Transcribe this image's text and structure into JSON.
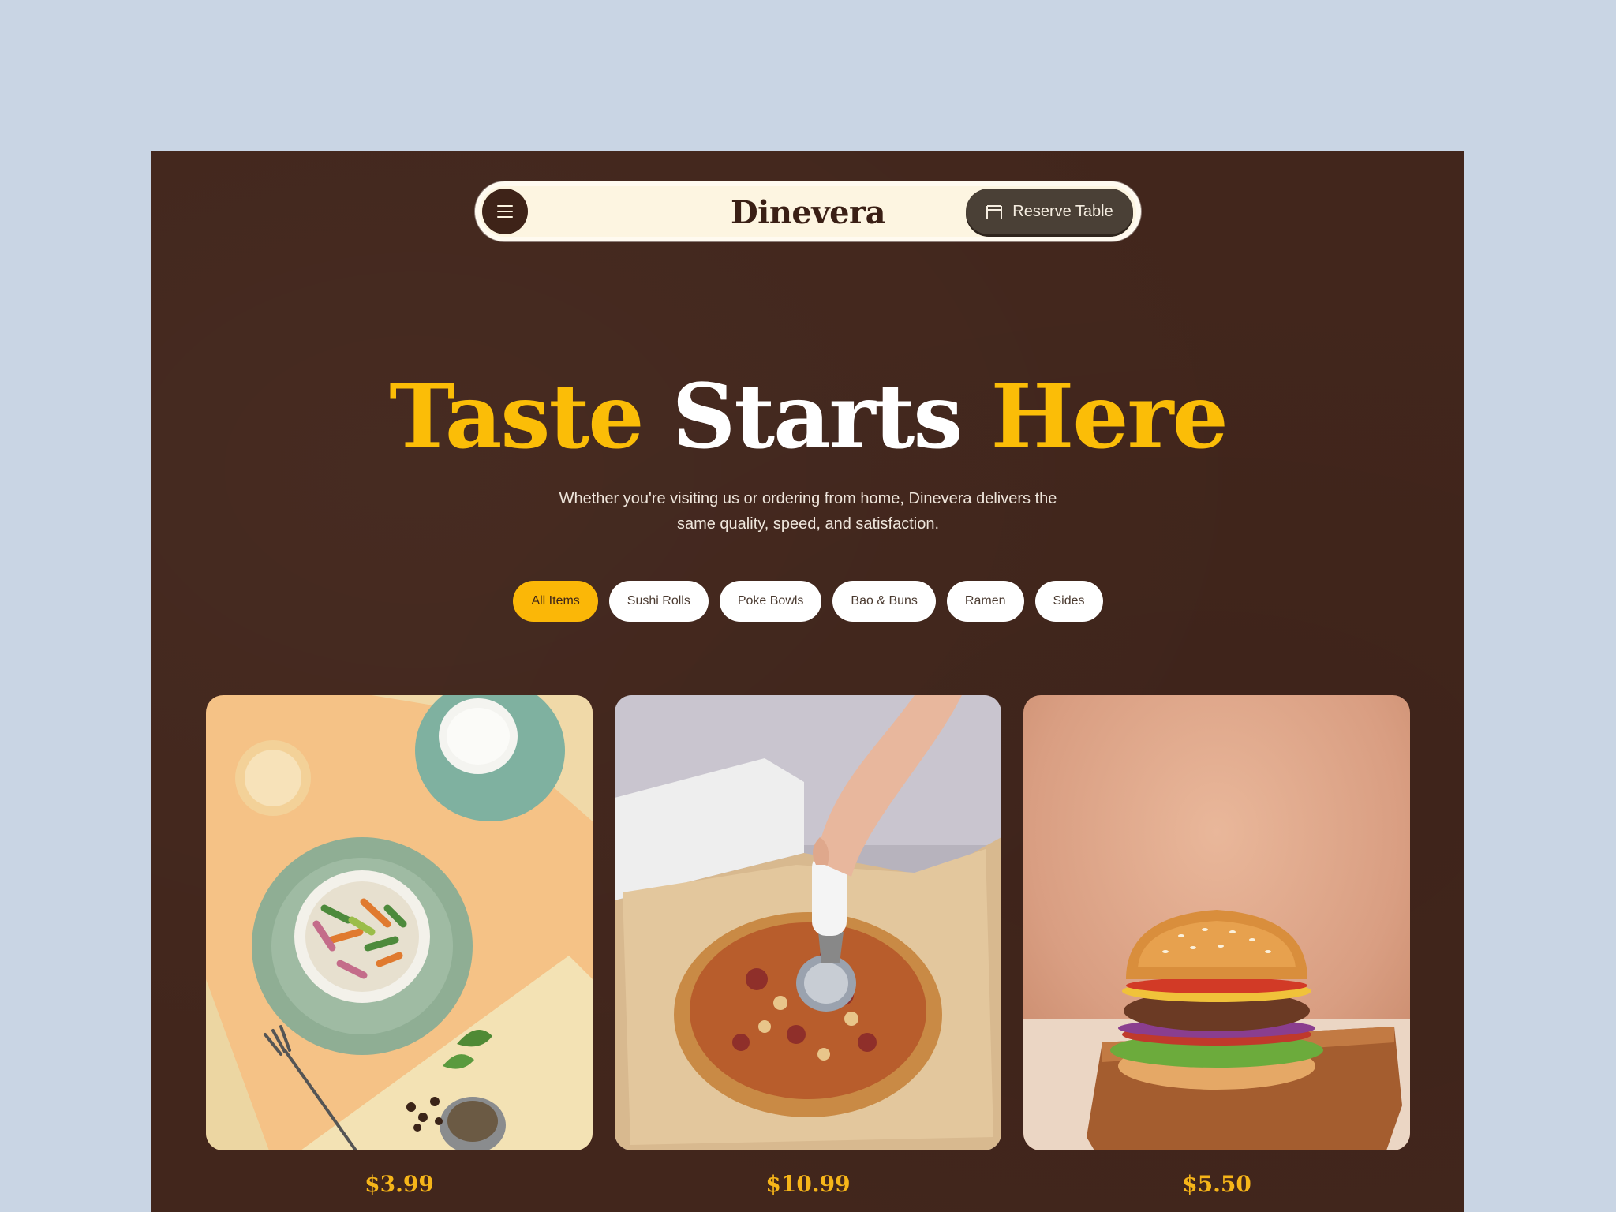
{
  "header": {
    "brand": "Dinevera",
    "reserve_label": "Reserve Table"
  },
  "hero": {
    "title_word1": "Taste",
    "title_word2": "Starts",
    "title_word3": "Here",
    "subtitle_line1": "Whether you're visiting us or ordering from home, Dinevera delivers the",
    "subtitle_line2": "same quality, speed, and satisfaction."
  },
  "filters": [
    "All Items",
    "Sushi Rolls",
    "Poke Bowls",
    "Bao & Buns",
    "Ramen",
    "Sides"
  ],
  "menu_items": [
    {
      "price": "$3.99"
    },
    {
      "price": "$10.99"
    },
    {
      "price": "$5.50"
    }
  ],
  "colors": {
    "page_bg": "#c9d5e4",
    "frame_bg": "#42261c",
    "accent_yellow": "#fbbd07",
    "navbar_bg": "#fdf5e1"
  },
  "icons": {
    "menu": "hamburger-icon",
    "reserve": "table-icon"
  }
}
